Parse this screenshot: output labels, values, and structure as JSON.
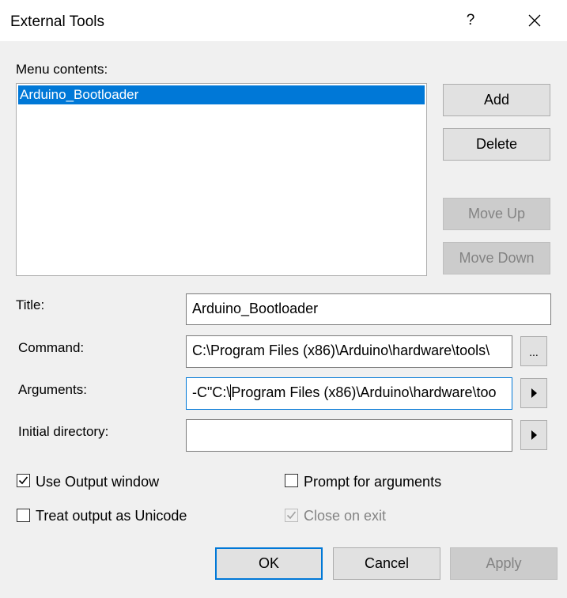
{
  "window": {
    "title": "External Tools",
    "help_label": "?",
    "close_icon": "close-icon"
  },
  "menu_contents": {
    "label": "Menu contents:",
    "items": [
      "Arduino_Bootloader"
    ]
  },
  "buttons": {
    "add": "Add",
    "delete": "Delete",
    "move_up": "Move Up",
    "move_down": "Move Down",
    "browse": "...",
    "ok": "OK",
    "cancel": "Cancel",
    "apply": "Apply"
  },
  "fields": {
    "title_label": "Title:",
    "title_value": "Arduino_Bootloader",
    "command_label": "Command:",
    "command_value": "C:\\Program Files (x86)\\Arduino\\hardware\\tools\\",
    "arguments_label": "Arguments:",
    "arguments_before_caret": "-C\"C:\\",
    "arguments_after_caret": "Program Files (x86)\\Arduino\\hardware\\too",
    "initial_directory_label": "Initial directory:",
    "initial_directory_value": ""
  },
  "options": {
    "use_output_window": {
      "label": "Use Output window",
      "checked": true,
      "enabled": true
    },
    "prompt_for_arguments": {
      "label": "Prompt for arguments",
      "checked": false,
      "enabled": true
    },
    "treat_output_as_unicode": {
      "label": "Treat output as Unicode",
      "checked": false,
      "enabled": true
    },
    "close_on_exit": {
      "label": "Close on exit",
      "checked": true,
      "enabled": false
    }
  },
  "colors": {
    "accent": "#0078d7",
    "dialog_bg": "#f0f0f0",
    "disabled_text": "#838383"
  }
}
